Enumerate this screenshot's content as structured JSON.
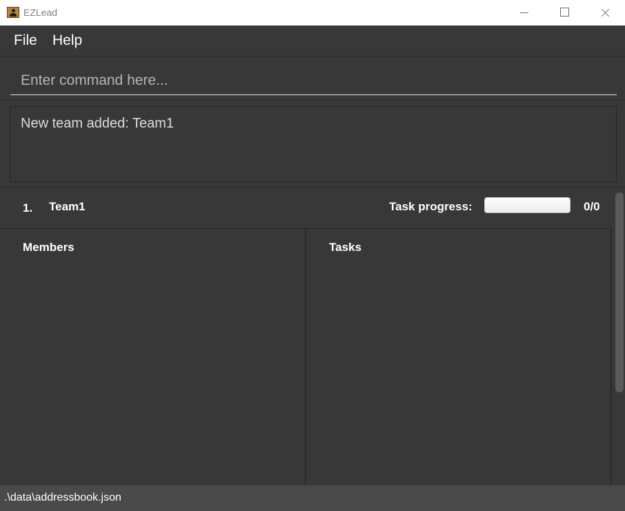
{
  "window": {
    "title": "EZLead",
    "icon": "app-icon",
    "controls": [
      "minimize-icon",
      "maximize-icon",
      "close-icon"
    ]
  },
  "menu": {
    "file": "File",
    "help": "Help"
  },
  "command": {
    "placeholder": "Enter command here...",
    "value": ""
  },
  "result": {
    "message": "New team added: Team1"
  },
  "teams": [
    {
      "index": "1.",
      "name": "Team1",
      "progress_label": "Task progress:",
      "progress_fraction": 0,
      "progress_count": "0/0",
      "members_title": "Members",
      "tasks_title": "Tasks",
      "members": [],
      "tasks": []
    }
  ],
  "status": {
    "path": ".\\data\\addressbook.json"
  },
  "colors": {
    "background": "#383838",
    "border": "#2a2a2a",
    "statusbar": "#4a4a4a",
    "text": "#ffffff"
  }
}
